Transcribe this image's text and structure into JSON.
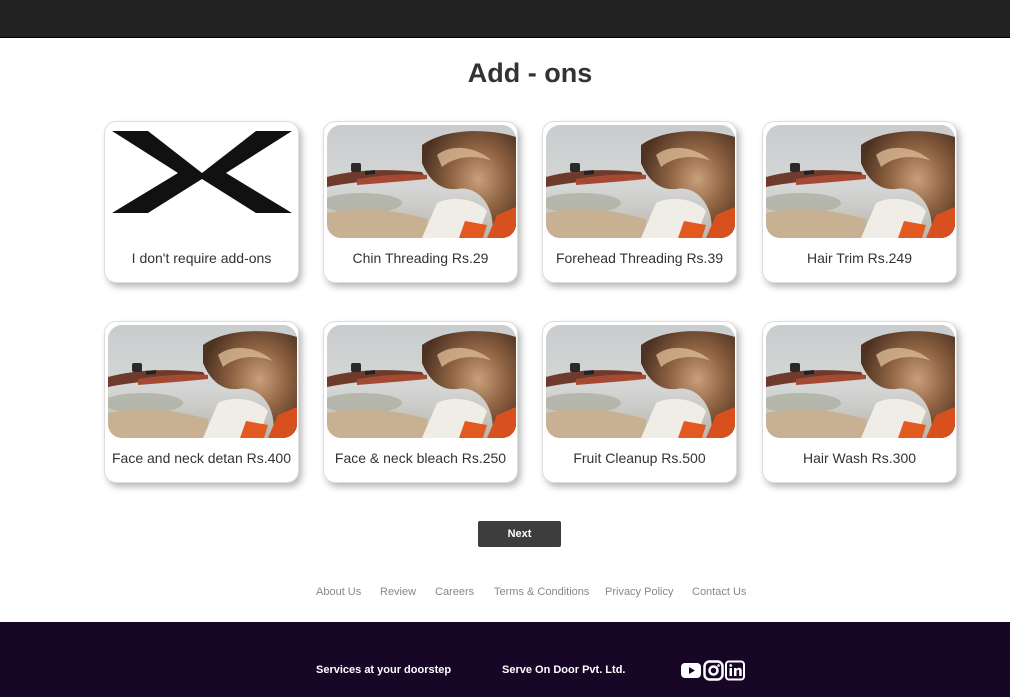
{
  "page": {
    "title": "Add - ons"
  },
  "addons": [
    {
      "label": "I don't require add-ons",
      "image": "cross-icon"
    },
    {
      "label": "Chin Threading Rs.29",
      "image": "hair-styling-photo"
    },
    {
      "label": "Forehead Threading Rs.39",
      "image": "hair-styling-photo"
    },
    {
      "label": "Hair Trim Rs.249",
      "image": "hair-styling-photo"
    },
    {
      "label": "Face and neck detan Rs.400",
      "image": "hair-styling-photo"
    },
    {
      "label": "Face & neck bleach Rs.250",
      "image": "hair-styling-photo"
    },
    {
      "label": "Fruit Cleanup Rs.500",
      "image": "hair-styling-photo"
    },
    {
      "label": "Hair Wash Rs.300",
      "image": "hair-styling-photo"
    }
  ],
  "actions": {
    "next_label": "Next"
  },
  "footer_links": [
    "About Us",
    "Review",
    "Careers",
    "Terms & Conditions",
    "Privacy Policy",
    "Contact Us"
  ],
  "footer": {
    "tagline": "Services at your doorstep",
    "company": "Serve On Door Pvt. Ltd.",
    "social_icons": [
      "youtube-icon",
      "instagram-icon",
      "linkedin-icon"
    ]
  },
  "colors": {
    "topbar": "#222222",
    "footer_bg": "#180627",
    "button_bg": "#3d3d3d",
    "link_gray": "#888888"
  }
}
